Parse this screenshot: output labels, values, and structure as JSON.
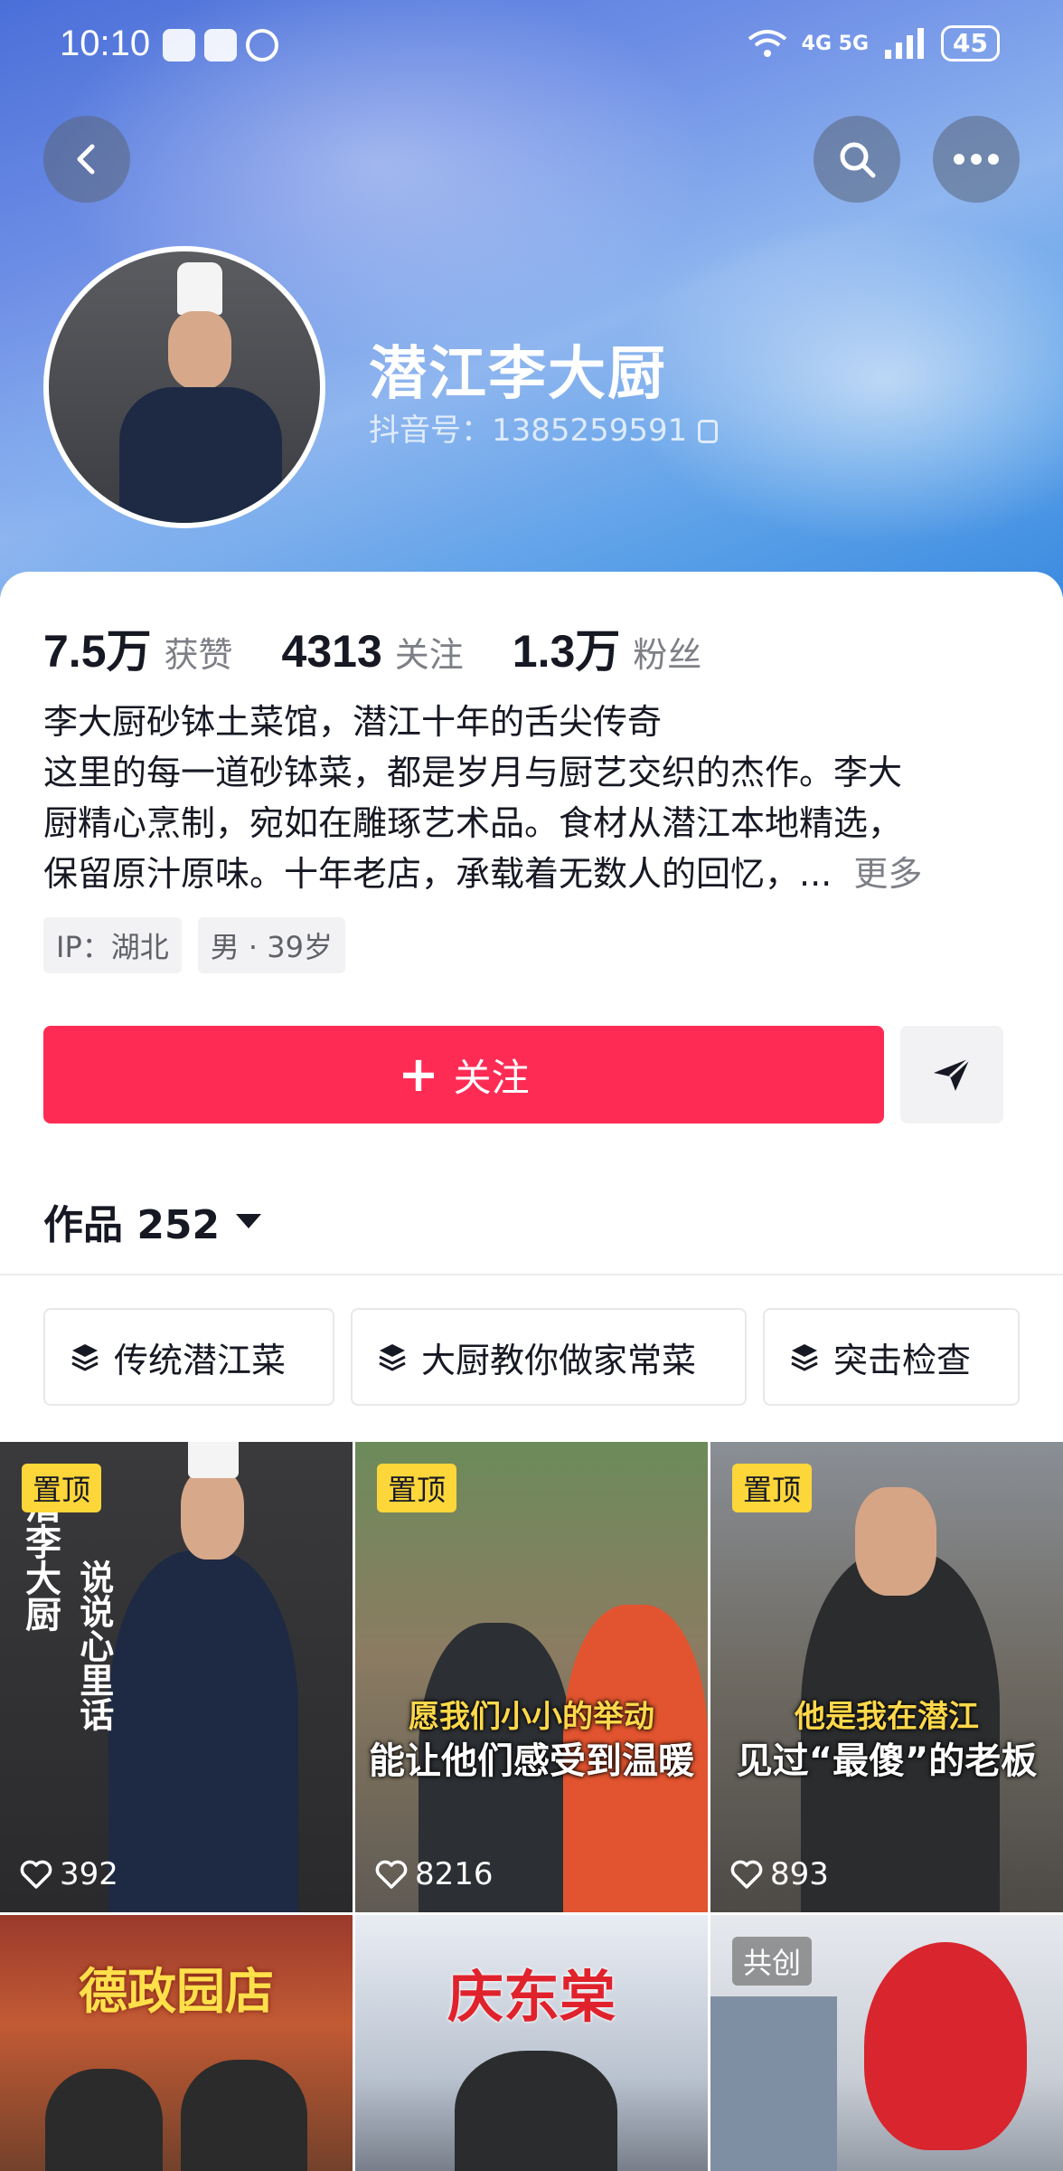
{
  "status_bar": {
    "time": "10:10",
    "network": "4G 5G",
    "battery": "45"
  },
  "profile": {
    "name": "潜江李大厨",
    "douyin_id": "抖音号：1385259591",
    "stats": [
      {
        "value": "7.5万",
        "label": "获赞"
      },
      {
        "value": "4313",
        "label": "关注"
      },
      {
        "value": "1.3万",
        "label": "粉丝"
      }
    ],
    "bio": [
      "李大厨砂钵土菜馆，潜江十年的舌尖传奇",
      "这里的每一道砂钵菜，都是岁月与厨艺交织的杰作。李大",
      "厨精心烹制，宛如在雕琢艺术品。食材从潜江本地精选，",
      "保留原汁原味。十年老店，承载着无数人的回忆，..."
    ],
    "bio_more": "更多",
    "tags": [
      "IP：湖北",
      "男 · 39岁"
    ],
    "follow_label": "关注",
    "works_label": "作品 252"
  },
  "collections": [
    {
      "label": "传统潜江菜"
    },
    {
      "label": "大厨教你做家常菜"
    },
    {
      "label": "突击检查"
    }
  ],
  "videos": [
    {
      "badge": "置顶",
      "likes": "392",
      "text_a": "潜李大厨",
      "text_b": "说说心里话"
    },
    {
      "badge": "置顶",
      "likes": "8216",
      "text_a": "愿我们小小的举动",
      "text_b": "能让他们感受到温暖"
    },
    {
      "badge": "置顶",
      "likes": "893",
      "text_a": "他是我在潜江",
      "text_b": "见过“最傻”的老板"
    },
    {
      "title": "德政园店"
    },
    {
      "title": "庆东棠"
    },
    {
      "badge": "共创"
    }
  ],
  "colors": {
    "accent": "#fe2c55",
    "pin": "#fdd63a"
  },
  "icons": [
    "back-icon",
    "search-icon",
    "more-icon",
    "copy-icon",
    "share-icon",
    "layers-icon",
    "heart-icon"
  ]
}
